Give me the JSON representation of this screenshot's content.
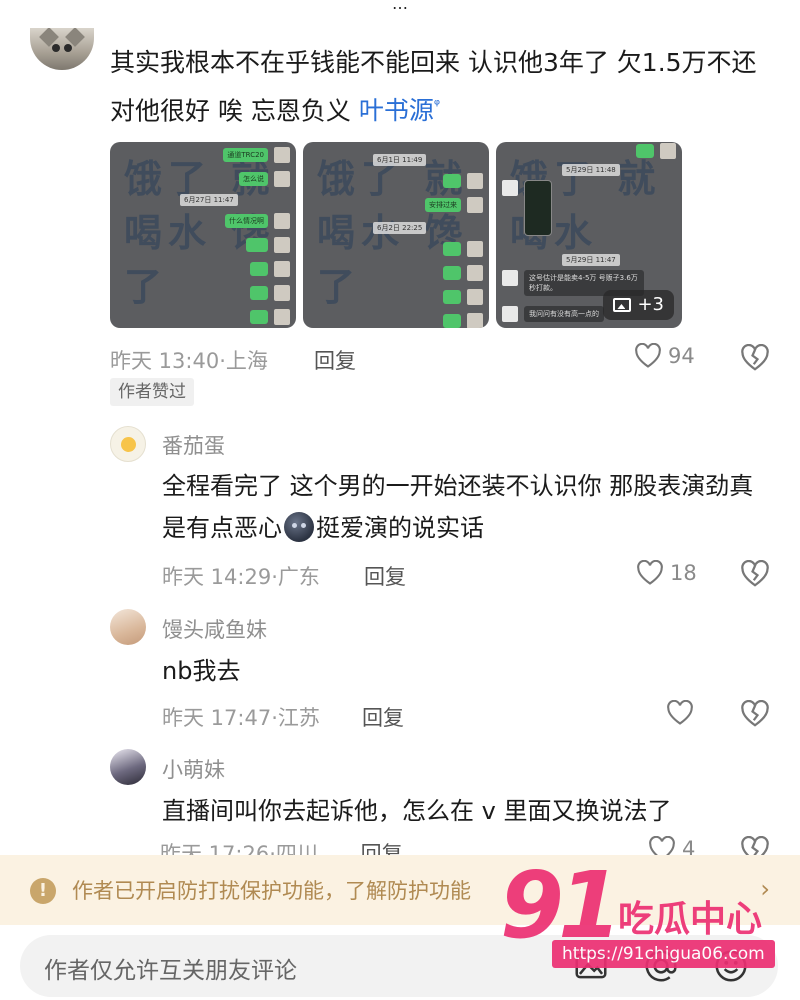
{
  "top_partial_title": "…",
  "main_comment": {
    "text_before_link": "其实我根本不在乎钱能不能回来 认识他3年了 欠1.5万不还 对他很好 唉 忘恩负义 ",
    "link_text": "叶书源",
    "images": [
      {
        "bg_text": "饿了 就喝水 馋了",
        "bubbles": [
          "通道TRC20",
          "怎么说",
          "什么情况啊"
        ],
        "stamp": "6月27日 11:47"
      },
      {
        "bg_text": "饿了 就喝水 馋了",
        "bubbles": [
          "安排过来"
        ],
        "stamps": [
          "6月1日 11:49",
          "6月2日 22:25"
        ]
      },
      {
        "bg_text": "饿了 就喝水",
        "stamps": [
          "5月29日 11:48",
          "5月29日 11:47"
        ],
        "messages": [
          "这号估计是能卖4-5万 号贩子3.6万秒打款。",
          "我问问有没有高一点的"
        ]
      }
    ],
    "more_images": "+3",
    "time": "昨天 13:40",
    "location": "上海",
    "reply_label": "回复",
    "likes": "94",
    "author_liked": "作者赞过"
  },
  "replies": [
    {
      "name": "番茄蛋",
      "text_1": "全程看完了 这个男的一开始还装不认识你 那股表演劲真是有点恶心",
      "text_2": "挺爱演的说实话",
      "time": "昨天 14:29",
      "location": "广东",
      "reply_label": "回复",
      "likes": "18"
    },
    {
      "name": "馒头咸鱼妹",
      "text": "nb我去",
      "time": "昨天 17:47",
      "location": "江苏",
      "reply_label": "回复",
      "likes": ""
    },
    {
      "name": "小萌妹",
      "text": "直播间叫你去起诉他，怎么在 v 里面又换说法了",
      "time": "昨天 17:26",
      "location": "四川",
      "reply_label": "回复",
      "likes": "4"
    }
  ],
  "notice": {
    "text": "作者已开启防打扰保护功能，了解防护功能"
  },
  "input": {
    "placeholder": "作者仅允许互关朋友评论"
  },
  "watermark": {
    "logo": "91",
    "name": "吃瓜中心",
    "url": "https://91chigua06.com"
  },
  "colors": {
    "link": "#2a6fd6",
    "notice_bg": "#fbf2e2",
    "notice_text": "#b08a52",
    "watermark": "#ec2f72",
    "chat_green": "#4fc56a"
  }
}
